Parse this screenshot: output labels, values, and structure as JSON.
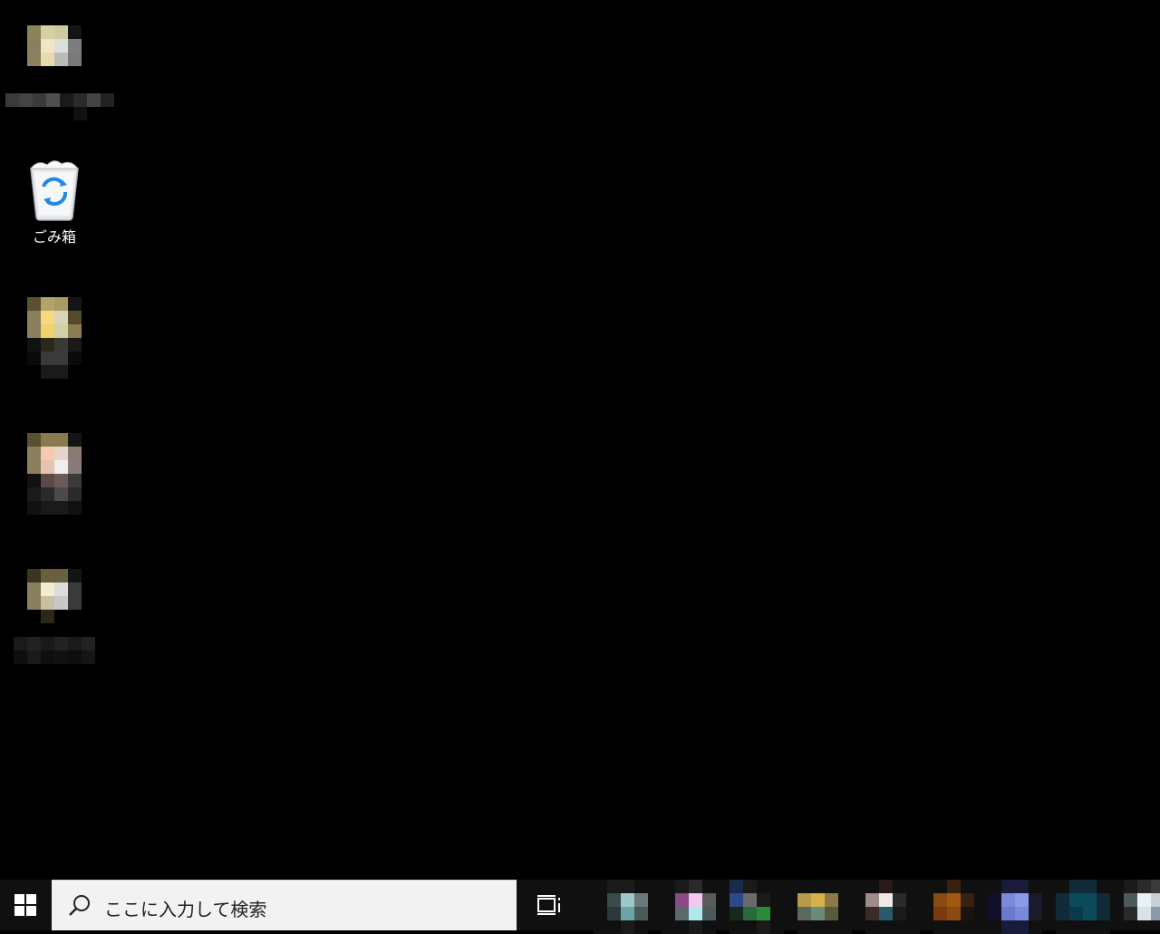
{
  "desktop": {
    "icons": [
      {
        "name": "desktop-icon-1",
        "label": ""
      },
      {
        "name": "recycle-bin",
        "label": "ごみ箱"
      },
      {
        "name": "desktop-icon-3",
        "label": ""
      },
      {
        "name": "desktop-icon-4",
        "label": ""
      },
      {
        "name": "desktop-icon-5",
        "label": ""
      }
    ]
  },
  "taskbar": {
    "start_icon": "windows-logo-icon",
    "search": {
      "placeholder": "ここに入力して検索",
      "icon": "search-icon"
    },
    "task_view_icon": "task-view-icon",
    "pinned_apps": [
      "app-1",
      "app-2",
      "app-3",
      "app-4",
      "app-5",
      "app-6",
      "app-7",
      "app-8",
      "app-9"
    ]
  },
  "colors": {
    "desktop_bg": "#000000",
    "taskbar_bg": "#101010",
    "search_bg": "#f2f2f2",
    "recycle_accent": "#1e88e5"
  }
}
